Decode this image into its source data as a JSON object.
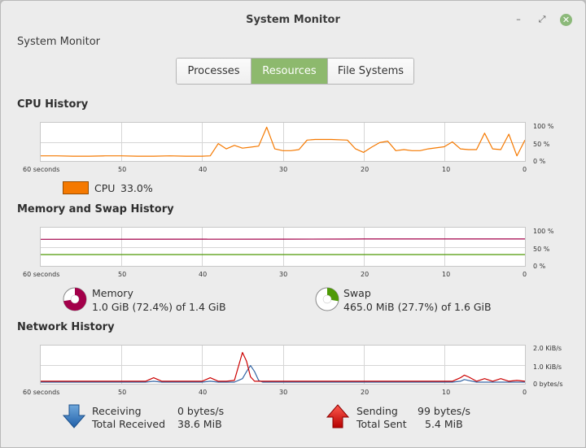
{
  "window": {
    "title": "System Monitor",
    "subtitle": "System Monitor",
    "controls": {
      "minimize": "–",
      "maximize": "⤢",
      "close": "✕"
    }
  },
  "tabs": [
    {
      "label": "Processes",
      "active": false
    },
    {
      "label": "Resources",
      "active": true
    },
    {
      "label": "File Systems",
      "active": false
    }
  ],
  "cpu": {
    "title": "CPU History",
    "y_ticks": [
      "100 %",
      "50 %",
      "0 %"
    ],
    "x_ticks": [
      "60 seconds",
      "50",
      "40",
      "30",
      "20",
      "10",
      "0"
    ],
    "legend_label": "CPU",
    "legend_value": "33.0%",
    "color": "#f57900"
  },
  "memory": {
    "title": "Memory and Swap History",
    "y_ticks": [
      "100 %",
      "50 %",
      "0 %"
    ],
    "x_ticks": [
      "60 seconds",
      "50",
      "40",
      "30",
      "20",
      "10",
      "0"
    ],
    "memory_label": "Memory",
    "memory_value": "1.0 GiB (72.4%) of 1.4 GiB",
    "memory_fraction": 0.724,
    "memory_color": "#a3004a",
    "swap_label": "Swap",
    "swap_value": "465.0 MiB (27.7%) of 1.6 GiB",
    "swap_fraction": 0.277,
    "swap_color": "#4e9a06"
  },
  "network": {
    "title": "Network History",
    "y_ticks": [
      "2.0 KiB/s",
      "1.0 KiB/s",
      "0 bytes/s"
    ],
    "x_ticks": [
      "60 seconds",
      "50",
      "40",
      "30",
      "20",
      "10",
      "0"
    ],
    "receiving_label": "Receiving",
    "receiving_value": "0 bytes/s",
    "total_received_label": "Total Received",
    "total_received_value": "38.6 MiB",
    "sending_label": "Sending",
    "sending_value": "99 bytes/s",
    "total_sent_label": "Total Sent",
    "total_sent_value": "5.4 MiB",
    "receiving_color": "#3465a4",
    "sending_color": "#cc0000"
  },
  "chart_data": [
    {
      "type": "line",
      "title": "CPU History",
      "x": [
        60,
        58,
        56,
        54,
        52,
        50,
        48,
        46,
        44,
        42,
        40,
        39,
        38,
        37,
        36,
        35,
        34,
        33,
        32,
        31,
        30,
        29,
        28,
        27,
        26,
        24,
        22,
        21,
        20,
        19,
        18,
        17,
        16,
        15,
        14,
        13,
        12,
        10,
        9,
        8,
        7,
        6,
        5,
        4,
        3,
        2,
        1,
        0
      ],
      "series": [
        {
          "name": "CPU",
          "values": [
            10,
            10,
            9,
            9,
            10,
            10,
            9,
            9,
            10,
            9,
            9,
            10,
            45,
            30,
            40,
            32,
            35,
            38,
            92,
            30,
            25,
            25,
            28,
            55,
            57,
            57,
            55,
            30,
            20,
            35,
            48,
            52,
            25,
            28,
            25,
            25,
            30,
            36,
            50,
            30,
            28,
            28,
            75,
            30,
            28,
            72,
            10,
            55
          ]
        }
      ],
      "xlim": [
        60,
        0
      ],
      "ylim": [
        0,
        100
      ],
      "grid": true
    },
    {
      "type": "line",
      "title": "Memory and Swap History",
      "x": [
        60,
        30,
        22,
        20,
        0
      ],
      "series": [
        {
          "name": "Memory",
          "values": [
            71.5,
            71.8,
            72.0,
            72.4,
            72.4
          ]
        },
        {
          "name": "Swap",
          "values": [
            27.7,
            27.7,
            27.7,
            27.7,
            27.7
          ]
        }
      ],
      "xlim": [
        60,
        0
      ],
      "ylim": [
        0,
        100
      ],
      "grid": true
    },
    {
      "type": "line",
      "title": "Network History",
      "x": [
        60,
        50,
        47,
        46,
        45,
        44,
        40,
        39,
        38,
        37,
        36,
        35,
        34.5,
        34,
        33.5,
        33,
        32.5,
        32,
        30,
        20,
        10,
        9,
        8,
        7.5,
        7,
        6,
        5,
        4,
        3,
        2,
        1,
        0
      ],
      "series": [
        {
          "name": "Receiving",
          "values": [
            0,
            0,
            0,
            0.05,
            0,
            0,
            0,
            0.05,
            0,
            0,
            0,
            0.2,
            0.6,
            0.95,
            0.6,
            0.1,
            0,
            0,
            0,
            0,
            0,
            0,
            0.05,
            0.15,
            0.1,
            0,
            0,
            0,
            0,
            0,
            0,
            0
          ]
        },
        {
          "name": "Sending",
          "values": [
            0.05,
            0.05,
            0.05,
            0.25,
            0.05,
            0.05,
            0.05,
            0.25,
            0.05,
            0.05,
            0.1,
            1.7,
            1.2,
            0.3,
            0.05,
            0.05,
            0.05,
            0.05,
            0.05,
            0.05,
            0.05,
            0.05,
            0.25,
            0.4,
            0.3,
            0.05,
            0.2,
            0.05,
            0.2,
            0.05,
            0.1,
            0.05
          ]
        }
      ],
      "xlim": [
        60,
        0
      ],
      "ylim": [
        0,
        2.0
      ],
      "grid": true
    }
  ]
}
